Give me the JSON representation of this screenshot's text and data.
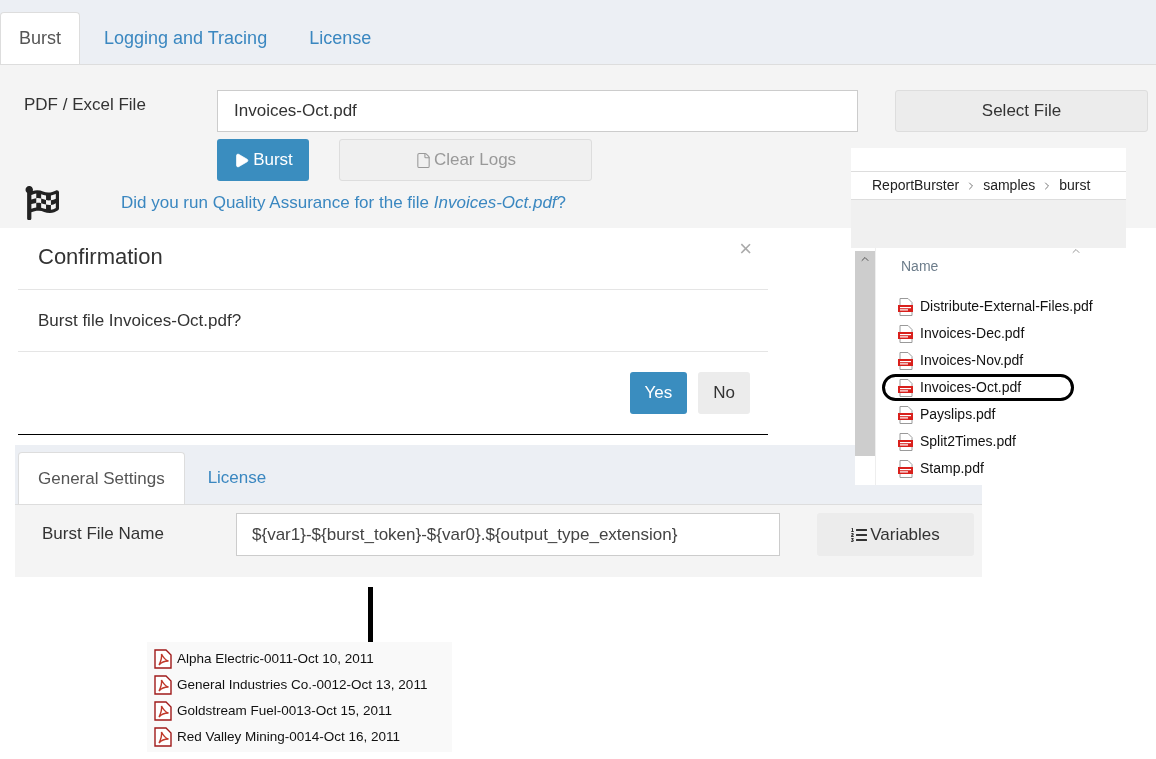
{
  "app_tabs": [
    {
      "label": "Burst",
      "selected": true
    },
    {
      "label": "Logging and Tracing",
      "selected": false
    },
    {
      "label": "License",
      "selected": false
    }
  ],
  "burst_form": {
    "file_label": "PDF / Excel File",
    "file_value": "Invoices-Oct.pdf",
    "select_button": "Select File",
    "burst_button": "Burst",
    "clear_logs_button": {
      "label": "Clear Logs",
      "disabled": true
    },
    "qa_prompt": "Did you run Quality Assurance for the file *Invoices-Oct.pdf*?"
  },
  "confirmation_dialog": {
    "title": "Confirmation",
    "close": "×",
    "message": "Burst file Invoices-Oct.pdf?",
    "buttons": [
      {
        "label": "Yes",
        "kind": "primary"
      },
      {
        "label": "No",
        "kind": "default"
      }
    ]
  },
  "file_explorer": {
    "breadcrumb": [
      "ReportBurster",
      "samples",
      "burst"
    ],
    "column": "Name",
    "files": [
      {
        "name": "Distribute-External-Files.pdf",
        "circled": false
      },
      {
        "name": "Invoices-Dec.pdf",
        "circled": false
      },
      {
        "name": "Invoices-Nov.pdf",
        "circled": false
      },
      {
        "name": "Invoices-Oct.pdf",
        "circled": true
      },
      {
        "name": "Payslips.pdf",
        "circled": false
      },
      {
        "name": "Split2Times.pdf",
        "circled": false
      },
      {
        "name": "Stamp.pdf",
        "circled": false
      }
    ]
  },
  "settings": {
    "tabs": [
      {
        "label": "General Settings",
        "selected": true
      },
      {
        "label": "License",
        "selected": false
      }
    ],
    "field_label": "Burst File Name",
    "field_value": "${var1}-${burst_token}-${var0}.${output_type_extension}",
    "variables_button": "Variables"
  },
  "output_files": [
    "Alpha Electric-0011-Oct 10, 2011",
    "General Industries Co.-0012-Oct 13, 2011",
    "Goldstream Fuel-0013-Oct 15, 2011",
    "Red Valley Mining-0014-Oct 16, 2011"
  ]
}
